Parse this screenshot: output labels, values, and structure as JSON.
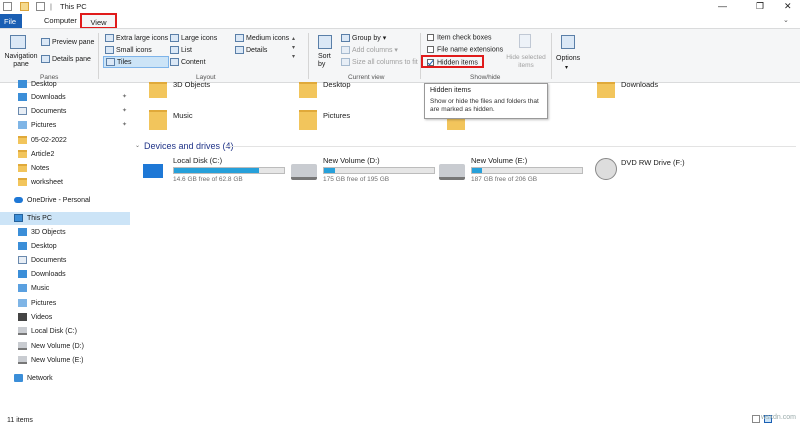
{
  "window": {
    "title": "This PC"
  },
  "tabs": [
    {
      "label": "File"
    },
    {
      "label": "Computer"
    },
    {
      "label": "View"
    }
  ],
  "ribbon": {
    "panes": {
      "label": "Panes",
      "navigation_pane": "Navigation pane",
      "preview_pane": "Preview pane",
      "details_pane": "Details pane"
    },
    "layout": {
      "label": "Layout",
      "items": [
        "Extra large icons",
        "Large icons",
        "Medium icons",
        "Small icons",
        "List",
        "Details",
        "Tiles",
        "Content"
      ]
    },
    "current_view": {
      "label": "Current view",
      "sort_by": "Sort by",
      "group_by": "Group by",
      "add_columns": "Add columns",
      "size_all_columns": "Size all columns to fit"
    },
    "show_hide": {
      "label": "Show/hide",
      "item_check_boxes": "Item check boxes",
      "file_name_extensions": "File name extensions",
      "hidden_items": "Hidden items",
      "hide_selected": "Hide selected items"
    },
    "options": {
      "label": "Options"
    }
  },
  "tooltip": {
    "title": "Hidden items",
    "body": "Show or hide the files and folders that are marked as hidden."
  },
  "nav": {
    "quick": [
      "Desktop",
      "Downloads",
      "Documents",
      "Pictures",
      "05-02-2022",
      "Article2",
      "Notes",
      "worksheet"
    ],
    "onedrive": "OneDrive - Personal",
    "this_pc": "This PC",
    "pc_items": [
      "3D Objects",
      "Desktop",
      "Documents",
      "Downloads",
      "Music",
      "Pictures",
      "Videos",
      "Local Disk (C:)",
      "New Volume (D:)",
      "New Volume (E:)"
    ],
    "network": "Network"
  },
  "folders": [
    "3D Objects",
    "Desktop",
    "Downloads",
    "Music",
    "Pictures",
    "Videos"
  ],
  "devices": {
    "header": "Devices and drives (4)",
    "drives": [
      {
        "name": "Local Disk (C:)",
        "free": "14.6 GB free of 62.8 GB",
        "used_fraction": 0.77
      },
      {
        "name": "New Volume (D:)",
        "free": "175 GB free of 195 GB",
        "used_fraction": 0.1
      },
      {
        "name": "New Volume (E:)",
        "free": "187 GB free of 206 GB",
        "used_fraction": 0.09
      },
      {
        "name": "DVD RW Drive (F:)",
        "free": ""
      }
    ]
  },
  "status": {
    "count": "11 items"
  },
  "watermark": "wsxdn.com"
}
